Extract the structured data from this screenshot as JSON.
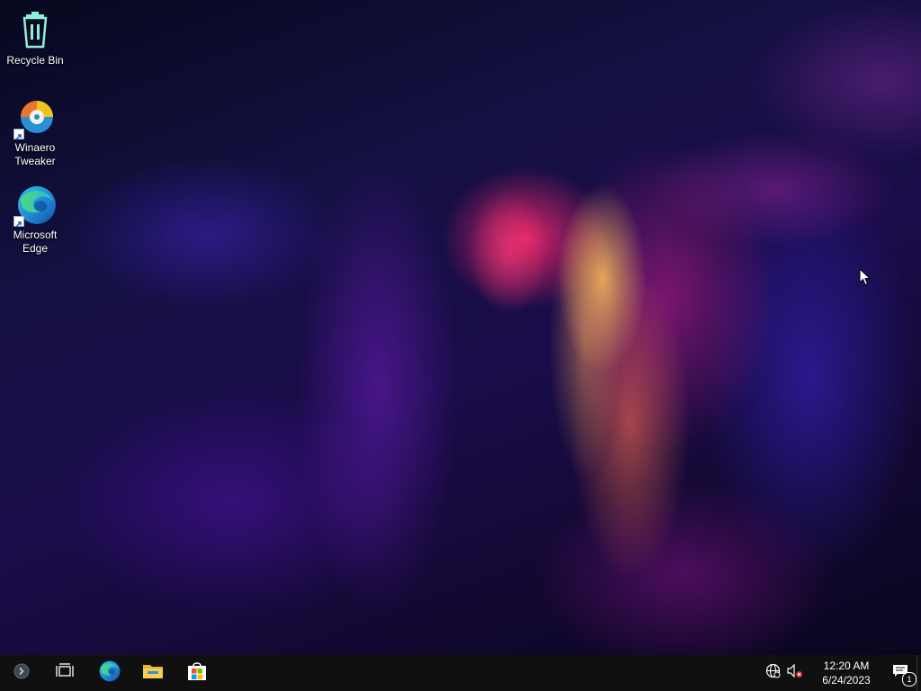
{
  "desktop": {
    "icons": [
      {
        "name": "recycle-bin",
        "label": "Recycle Bin"
      },
      {
        "name": "winaero-tweaker",
        "label": "Winaero Tweaker"
      },
      {
        "name": "microsoft-edge",
        "label": "Microsoft Edge"
      }
    ]
  },
  "taskbar": {
    "pinned": [
      {
        "name": "start-button",
        "icon": "start-icon"
      },
      {
        "name": "task-view-button",
        "icon": "task-view-icon"
      },
      {
        "name": "edge-taskbar-button",
        "icon": "edge-icon"
      },
      {
        "name": "file-explorer-button",
        "icon": "folder-icon"
      },
      {
        "name": "microsoft-store-button",
        "icon": "store-icon"
      }
    ],
    "tray": {
      "network_icon": "globe-icon",
      "volume_icon": "speaker-muted-icon",
      "time": "12:20 AM",
      "date": "6/24/2023",
      "notification_count": "1"
    }
  },
  "colors": {
    "taskbar_bg": "#101010",
    "label_text": "#ffffff"
  }
}
